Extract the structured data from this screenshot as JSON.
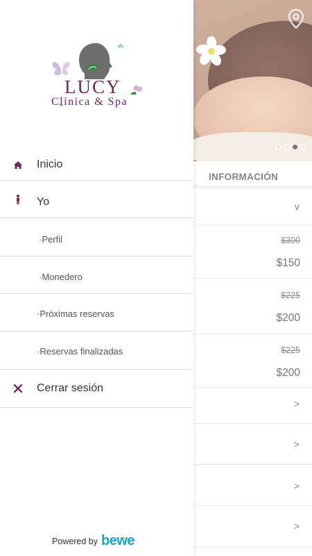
{
  "drawer": {
    "logo": {
      "title": "LUCY",
      "subtitle": "Clínica & Spa"
    },
    "items": [
      {
        "label": "Inicio",
        "icon": "home-icon"
      },
      {
        "label": "Yo",
        "icon": "person-icon"
      },
      {
        "label": "·Perfil"
      },
      {
        "label": "·Monedero"
      },
      {
        "label": "·Próximas reservas"
      },
      {
        "label": "·Reservas finalizadas"
      },
      {
        "label": "Cerrar sesión",
        "icon": "close-icon"
      }
    ],
    "footer": {
      "powered_by": "Powered by",
      "brand": "bewe"
    }
  },
  "background": {
    "carousel": {
      "total": 4,
      "active": 3
    },
    "section_title": "INFORMACIÓN",
    "prices": [
      {
        "old": "$300",
        "new": "$150"
      },
      {
        "old": "$225",
        "new": "$200"
      },
      {
        "old": "$225",
        "new": "$200"
      }
    ],
    "chevron_down": "v",
    "chevron_right": ">"
  },
  "colors": {
    "accent": "#6d2a58",
    "brand_bewe": "#17a7c6"
  }
}
